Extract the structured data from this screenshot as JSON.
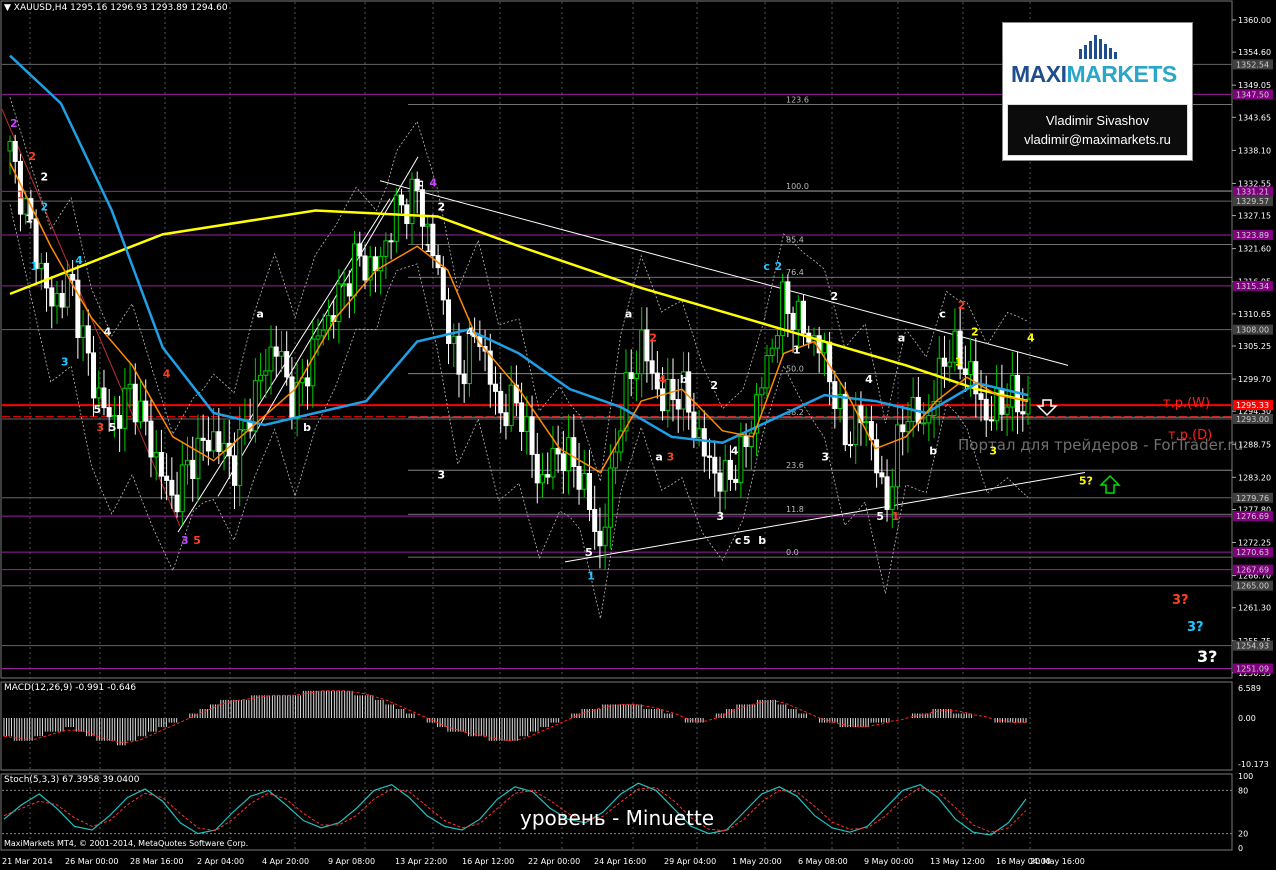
{
  "header": {
    "symbol": "XAUUSD,H4",
    "ohlc": "1295.16 1296.93 1293.89 1294.60"
  },
  "macd_header": "MACD(12,26,9) -0.991 -0.646",
  "stoch_header": "Stoch(5,3,3) 67.3958 39.0400",
  "copyright": "MaxiMarkets MT4, © 2001-2014, MetaQuotes Software Corp.",
  "logo": {
    "brand_left": "MAXI",
    "brand_right": "MARKETS",
    "name": "Vladimir Sivashov",
    "email": "vladimir@maximarkets.ru"
  },
  "watermark": "Портал для трейдеров - ForTrader.ru",
  "level_text": "уровень - Minuette",
  "tp_w": "т.р.(W)",
  "tp_d": "т.р.(D)",
  "colors": {
    "background": "#000000",
    "bull": "#00cc00",
    "bear": "#ffffff",
    "ma_yellow": "#ffff00",
    "ma_blue": "#1ea0e6",
    "ma_orange": "#ff8c00",
    "level_magenta": "#800080",
    "tp_red": "#ff0000"
  },
  "chart_data": {
    "type": "candlestick",
    "title": "XAUUSD,H4",
    "x_ticks": [
      "21 Mar 2014",
      "26 Mar 00:00",
      "28 Mar 16:00",
      "2 Apr 04:00",
      "4 Apr 20:00",
      "9 Apr 08:00",
      "13 Apr 22:00",
      "16 Apr 12:00",
      "22 Apr 00:00",
      "24 Apr 16:00",
      "29 Apr 04:00",
      "1 May 20:00",
      "6 May 08:00",
      "9 May 00:00",
      "13 May 12:00",
      "16 May 04:00",
      "20 May 16:00"
    ],
    "y_ticks": [
      "1360.00",
      "1354.60",
      "1349.05",
      "1343.65",
      "1338.10",
      "1332.55",
      "1327.15",
      "1321.60",
      "1316.05",
      "1310.65",
      "1305.25",
      "1299.70",
      "1294.30",
      "1288.75",
      "1283.20",
      "1277.80",
      "1272.25",
      "1266.70",
      "1261.30",
      "1255.75",
      "1250.35"
    ],
    "ylim": [
      1249.5,
      1361
    ],
    "price_labels": [
      {
        "value": 1352.54,
        "color": "#404040"
      },
      {
        "value": 1347.5,
        "color": "#800080"
      },
      {
        "value": 1331.21,
        "color": "#800080"
      },
      {
        "value": 1329.57,
        "color": "#404040"
      },
      {
        "value": 1323.89,
        "color": "#800080"
      },
      {
        "value": 1315.34,
        "color": "#800080"
      },
      {
        "value": 1308.0,
        "color": "#404040"
      },
      {
        "value": 1295.33,
        "color": "#ff0000"
      },
      {
        "value": 1293.0,
        "color": "#404040"
      },
      {
        "value": 1279.76,
        "color": "#404040"
      },
      {
        "value": 1276.69,
        "color": "#800080"
      },
      {
        "value": 1270.63,
        "color": "#800080"
      },
      {
        "value": 1267.69,
        "color": "#800080"
      },
      {
        "value": 1265.0,
        "color": "#404040"
      },
      {
        "value": 1254.93,
        "color": "#404040"
      },
      {
        "value": 1251.09,
        "color": "#800080"
      }
    ],
    "fib_levels": [
      {
        "label": "123.6",
        "value": 1345.8
      },
      {
        "label": "100.0",
        "value": 1331.3
      },
      {
        "label": "85.4",
        "value": 1322.3
      },
      {
        "label": "76.4",
        "value": 1316.8
      },
      {
        "label": "50.0",
        "value": 1300.6
      },
      {
        "label": "38.2",
        "value": 1293.3
      },
      {
        "label": "23.6",
        "value": 1284.4
      },
      {
        "label": "11.8",
        "value": 1277.0
      },
      {
        "label": "0.0",
        "value": 1269.8
      }
    ],
    "close_path": [
      [
        0,
        1338
      ],
      [
        0.02,
        1325
      ],
      [
        0.04,
        1312
      ],
      [
        0.06,
        1316
      ],
      [
        0.08,
        1300
      ],
      [
        0.1,
        1292
      ],
      [
        0.12,
        1298
      ],
      [
        0.14,
        1288
      ],
      [
        0.16,
        1279
      ],
      [
        0.18,
        1287
      ],
      [
        0.2,
        1290
      ],
      [
        0.22,
        1285
      ],
      [
        0.24,
        1297
      ],
      [
        0.26,
        1306
      ],
      [
        0.28,
        1295
      ],
      [
        0.3,
        1306
      ],
      [
        0.32,
        1312
      ],
      [
        0.34,
        1320
      ],
      [
        0.36,
        1318
      ],
      [
        0.38,
        1328
      ],
      [
        0.4,
        1331
      ],
      [
        0.42,
        1318
      ],
      [
        0.44,
        1300
      ],
      [
        0.46,
        1308
      ],
      [
        0.48,
        1294
      ],
      [
        0.5,
        1296
      ],
      [
        0.52,
        1282
      ],
      [
        0.54,
        1288
      ],
      [
        0.56,
        1284
      ],
      [
        0.58,
        1271
      ],
      [
        0.6,
        1294
      ],
      [
        0.62,
        1306
      ],
      [
        0.64,
        1296
      ],
      [
        0.66,
        1298
      ],
      [
        0.68,
        1288
      ],
      [
        0.7,
        1282
      ],
      [
        0.72,
        1287
      ],
      [
        0.74,
        1300
      ],
      [
        0.76,
        1313
      ],
      [
        0.78,
        1308
      ],
      [
        0.8,
        1304
      ],
      [
        0.82,
        1290
      ],
      [
        0.84,
        1294
      ],
      [
        0.86,
        1278
      ],
      [
        0.88,
        1295
      ],
      [
        0.9,
        1292
      ],
      [
        0.92,
        1305
      ],
      [
        0.94,
        1302
      ],
      [
        0.96,
        1293
      ],
      [
        0.98,
        1297
      ],
      [
        1,
        1294.6
      ]
    ],
    "ma_yellow": [
      [
        0,
        1314
      ],
      [
        0.06,
        1318
      ],
      [
        0.15,
        1324
      ],
      [
        0.3,
        1328
      ],
      [
        0.42,
        1327
      ],
      [
        0.5,
        1322
      ],
      [
        0.62,
        1315
      ],
      [
        0.72,
        1310
      ],
      [
        0.8,
        1306
      ],
      [
        0.88,
        1302
      ],
      [
        0.95,
        1298
      ],
      [
        1,
        1296
      ]
    ],
    "ma_blue": [
      [
        0,
        1354
      ],
      [
        0.05,
        1346
      ],
      [
        0.1,
        1328
      ],
      [
        0.15,
        1305
      ],
      [
        0.2,
        1294
      ],
      [
        0.25,
        1292
      ],
      [
        0.3,
        1294
      ],
      [
        0.35,
        1296
      ],
      [
        0.4,
        1306
      ],
      [
        0.45,
        1308
      ],
      [
        0.5,
        1304
      ],
      [
        0.55,
        1298
      ],
      [
        0.6,
        1295
      ],
      [
        0.65,
        1290
      ],
      [
        0.7,
        1289
      ],
      [
        0.75,
        1293
      ],
      [
        0.8,
        1297
      ],
      [
        0.85,
        1296
      ],
      [
        0.9,
        1294
      ],
      [
        0.95,
        1299
      ],
      [
        1,
        1297
      ]
    ],
    "ma_orange": [
      [
        0,
        1336
      ],
      [
        0.04,
        1322
      ],
      [
        0.08,
        1310
      ],
      [
        0.12,
        1302
      ],
      [
        0.16,
        1290
      ],
      [
        0.2,
        1286
      ],
      [
        0.24,
        1292
      ],
      [
        0.28,
        1298
      ],
      [
        0.32,
        1310
      ],
      [
        0.36,
        1318
      ],
      [
        0.4,
        1322
      ],
      [
        0.43,
        1318
      ],
      [
        0.46,
        1306
      ],
      [
        0.5,
        1298
      ],
      [
        0.54,
        1288
      ],
      [
        0.58,
        1284
      ],
      [
        0.62,
        1296
      ],
      [
        0.66,
        1298
      ],
      [
        0.7,
        1291
      ],
      [
        0.73,
        1290
      ],
      [
        0.76,
        1304
      ],
      [
        0.79,
        1306
      ],
      [
        0.82,
        1298
      ],
      [
        0.85,
        1288
      ],
      [
        0.88,
        1290
      ],
      [
        0.91,
        1296
      ],
      [
        0.94,
        1300
      ],
      [
        0.97,
        1297
      ],
      [
        1,
        1296
      ]
    ],
    "annotations": [
      {
        "t": "2",
        "x": 0.0,
        "y": 1342,
        "c": "#cc44ff"
      },
      {
        "t": "2",
        "x": 0.018,
        "y": 1336.5,
        "c": "#ff4020"
      },
      {
        "t": "2",
        "x": 0.03,
        "y": 1333,
        "c": "#fff"
      },
      {
        "t": "1",
        "x": 0.007,
        "y": 1330,
        "c": "#ff4020"
      },
      {
        "t": "2",
        "x": 0.03,
        "y": 1328,
        "c": "#1ec8ff"
      },
      {
        "t": "1",
        "x": 0.015,
        "y": 1326,
        "c": "#fff"
      },
      {
        "t": "1",
        "x": 0.02,
        "y": 1318,
        "c": "#1ec8ff"
      },
      {
        "t": "4",
        "x": 0.064,
        "y": 1319,
        "c": "#1ec8ff"
      },
      {
        "t": "4",
        "x": 0.092,
        "y": 1307,
        "c": "#fff"
      },
      {
        "t": "3",
        "x": 0.05,
        "y": 1302,
        "c": "#1ec8ff"
      },
      {
        "t": "4",
        "x": 0.15,
        "y": 1300,
        "c": "#ff4020"
      },
      {
        "t": "3",
        "x": 0.085,
        "y": 1291,
        "c": "#ff4020"
      },
      {
        "t": "5",
        "x": 0.097,
        "y": 1291,
        "c": "#fff"
      },
      {
        "t": "5",
        "x": 0.082,
        "y": 1294,
        "c": "#fff"
      },
      {
        "t": "a",
        "x": 0.242,
        "y": 1310,
        "c": "#fff"
      },
      {
        "t": "b",
        "x": 0.288,
        "y": 1291,
        "c": "#fff"
      },
      {
        "t": "3",
        "x": 0.168,
        "y": 1272,
        "c": "#cc44ff"
      },
      {
        "t": "5",
        "x": 0.18,
        "y": 1272,
        "c": "#ff4020"
      },
      {
        "t": "c",
        "x": 0.4,
        "y": 1332,
        "c": "#fff"
      },
      {
        "t": "4",
        "x": 0.412,
        "y": 1332,
        "c": "#cc44ff"
      },
      {
        "t": "2",
        "x": 0.42,
        "y": 1328,
        "c": "#fff"
      },
      {
        "t": "1",
        "x": 0.407,
        "y": 1321,
        "c": "#fff"
      },
      {
        "t": "4",
        "x": 0.448,
        "y": 1307,
        "c": "#fff"
      },
      {
        "t": "3",
        "x": 0.42,
        "y": 1283,
        "c": "#fff"
      },
      {
        "t": "a",
        "x": 0.604,
        "y": 1310,
        "c": "#fff"
      },
      {
        "t": "2",
        "x": 0.628,
        "y": 1306,
        "c": "#ff4020"
      },
      {
        "t": "4",
        "x": 0.637,
        "y": 1299,
        "c": "#ff4020"
      },
      {
        "t": "b",
        "x": 0.658,
        "y": 1299,
        "c": "#fff"
      },
      {
        "t": "2",
        "x": 0.688,
        "y": 1298,
        "c": "#fff"
      },
      {
        "t": "4",
        "x": 0.708,
        "y": 1287,
        "c": "#fff"
      },
      {
        "t": "a",
        "x": 0.634,
        "y": 1286,
        "c": "#fff"
      },
      {
        "t": "3",
        "x": 0.645,
        "y": 1286,
        "c": "#ff4020"
      },
      {
        "t": "3",
        "x": 0.694,
        "y": 1276,
        "c": "#fff"
      },
      {
        "t": "c",
        "x": 0.712,
        "y": 1272,
        "c": "#fff"
      },
      {
        "t": "5",
        "x": 0.72,
        "y": 1272,
        "c": "#fff"
      },
      {
        "t": "b",
        "x": 0.735,
        "y": 1272,
        "c": "#fff"
      },
      {
        "t": "5",
        "x": 0.565,
        "y": 1270,
        "c": "#fff"
      },
      {
        "t": "1",
        "x": 0.567,
        "y": 1266,
        "c": "#1ec8ff"
      },
      {
        "t": "c",
        "x": 0.74,
        "y": 1318,
        "c": "#1ec8ff"
      },
      {
        "t": "2",
        "x": 0.751,
        "y": 1318,
        "c": "#1ec8ff"
      },
      {
        "t": "2",
        "x": 0.806,
        "y": 1313,
        "c": "#fff"
      },
      {
        "t": "1",
        "x": 0.769,
        "y": 1304,
        "c": "#fff"
      },
      {
        "t": "4",
        "x": 0.84,
        "y": 1299,
        "c": "#fff"
      },
      {
        "t": "a",
        "x": 0.872,
        "y": 1306,
        "c": "#fff"
      },
      {
        "t": "3",
        "x": 0.797,
        "y": 1286,
        "c": "#fff"
      },
      {
        "t": "5",
        "x": 0.851,
        "y": 1276,
        "c": "#fff"
      },
      {
        "t": "1",
        "x": 0.866,
        "y": 1276,
        "c": "#ff4020"
      },
      {
        "t": "b",
        "x": 0.903,
        "y": 1287,
        "c": "#fff"
      },
      {
        "t": "c",
        "x": 0.913,
        "y": 1310,
        "c": "#fff"
      },
      {
        "t": "2",
        "x": 0.931,
        "y": 1311.5,
        "c": "#ff4020"
      },
      {
        "t": "2",
        "x": 0.944,
        "y": 1307,
        "c": "#ffff00"
      },
      {
        "t": "1",
        "x": 0.928,
        "y": 1302,
        "c": "#ffff00"
      },
      {
        "t": "4",
        "x": 0.999,
        "y": 1306,
        "c": "#ffff00"
      },
      {
        "t": "3",
        "x": 0.962,
        "y": 1287,
        "c": "#ffff00"
      },
      {
        "t": "5?",
        "x": 1.05,
        "y": 1282,
        "c": "#ffff00"
      }
    ]
  },
  "macd": {
    "ticks": [
      "6.589",
      "0.00",
      "-10.173"
    ],
    "range": [
      -11,
      7.5
    ],
    "hist": [
      -4,
      -5,
      -5,
      -4,
      -3,
      -3,
      -2,
      -3,
      -4,
      -5,
      -5,
      -6,
      -5,
      -4,
      -3,
      -2,
      -1,
      0,
      1,
      2,
      3,
      4,
      4,
      4,
      5,
      5,
      5,
      5,
      5,
      6,
      6,
      6,
      6,
      6,
      5,
      5,
      4,
      3,
      2,
      1,
      0,
      -1,
      -2,
      -3,
      -3,
      -4,
      -4,
      -5,
      -5,
      -5,
      -4,
      -3,
      -2,
      -1,
      0,
      1,
      2,
      2,
      3,
      3,
      3,
      3,
      2,
      2,
      1,
      0,
      -1,
      -1,
      0,
      1,
      2,
      3,
      3,
      4,
      4,
      3,
      2,
      1,
      0,
      -1,
      -1,
      -2,
      -2,
      -2,
      -1,
      -1,
      0,
      0,
      1,
      1,
      2,
      2,
      1,
      1,
      0,
      0,
      -1,
      -1,
      -1,
      -1
    ]
  },
  "stoch": {
    "ticks": [
      "100",
      "80",
      "20",
      "0"
    ],
    "k": [
      40,
      60,
      75,
      55,
      30,
      25,
      45,
      70,
      82,
      65,
      35,
      20,
      25,
      50,
      72,
      80,
      60,
      38,
      28,
      35,
      55,
      80,
      88,
      70,
      45,
      30,
      25,
      40,
      68,
      85,
      78,
      55,
      40,
      35,
      50,
      75,
      90,
      80,
      55,
      30,
      20,
      25,
      50,
      75,
      85,
      72,
      45,
      28,
      22,
      30,
      55,
      80,
      88,
      70,
      40,
      22,
      18,
      35,
      68
    ],
    "d": [
      45,
      55,
      65,
      60,
      42,
      30,
      38,
      60,
      76,
      70,
      48,
      28,
      24,
      40,
      62,
      76,
      68,
      48,
      32,
      32,
      45,
      68,
      82,
      78,
      58,
      38,
      28,
      34,
      55,
      76,
      80,
      66,
      48,
      38,
      44,
      64,
      82,
      84,
      66,
      42,
      26,
      24,
      40,
      64,
      80,
      78,
      58,
      36,
      26,
      28,
      44,
      68,
      84,
      78,
      56,
      32,
      22,
      28,
      52
    ]
  }
}
